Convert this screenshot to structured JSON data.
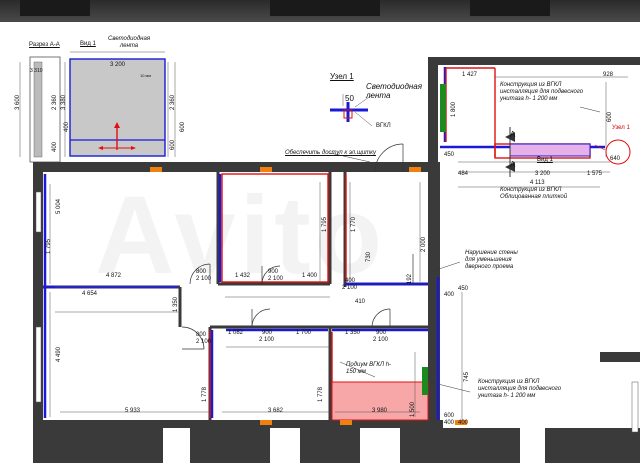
{
  "watermark": "Avito",
  "section": {
    "title": "Разрез А-А",
    "view": "Вид 1",
    "led_label": "Светодиодная лента",
    "dims": [
      "3 200",
      "10 мм",
      "3 600",
      "3 380",
      "2 360",
      "400",
      "2 360",
      "600",
      "400",
      "600",
      "3 310"
    ]
  },
  "node": {
    "title": "Узел 1",
    "led_label": "Светодиодная лента",
    "size": "50",
    "gkl": "ВГКЛ"
  },
  "notes": {
    "access": "Обеспечить доступ к эл.щитку",
    "construction_top": "Конструкция из ВГКЛ инсталляция для подвесного унитаза h- 1 200 мм",
    "tile_clad": "Конструкция из ВГКЛ Облицованная плиткой",
    "wall_break": "Нарушение стены для уменьшения дверного проема",
    "construction_bottom": "Конструкция из ВГКЛ инсталляция для подвесного унитаза h- 1 200 мм",
    "podium": "Подиум ВГКЛ h-150 мм"
  },
  "markers": {
    "node1": "Узел 1",
    "view1": "Вид 1",
    "section_a": "А"
  },
  "dims": {
    "right_top": [
      "1 427",
      "928",
      "1 800",
      "450",
      "640",
      "3 200",
      "4 113",
      "484",
      "1 575",
      "600"
    ],
    "left": [
      "5 004",
      "1 795",
      "4 490",
      "4 654",
      "4 872"
    ],
    "mid": [
      "800",
      "2 100",
      "900",
      "2 100",
      "1 432",
      "1 400",
      "1 795",
      "1 770",
      "400",
      "2 100",
      "192",
      "2 000",
      "1 350"
    ],
    "lower": [
      "800",
      "2 100",
      "1 082",
      "900",
      "2 100",
      "1 700",
      "1 350",
      "900",
      "2 100",
      "1 778",
      "1 778",
      "5 933",
      "3 682",
      "1 500",
      "3 980",
      "745",
      "600",
      "400",
      "400",
      "450",
      "400",
      "730",
      "410"
    ]
  },
  "colors": {
    "wall": "#3a3a3a",
    "blue": "#1a1ad6",
    "red": "#e01010",
    "pink": "#f7a7a7",
    "green": "#1e8a1e",
    "orange": "#f08010"
  }
}
